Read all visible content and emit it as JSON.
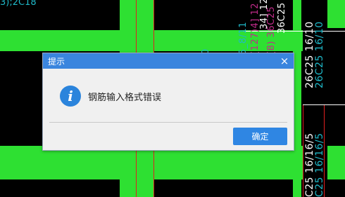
{
  "background": {
    "texts": [
      {
        "text": "3);2C18",
        "color": "#1fb8c8"
      },
      {
        "text": "0",
        "color": "#1fb8c8"
      },
      {
        "text": "5_8/11",
        "color": "#1fb8c8"
      },
      {
        "text": "(127)4] 12",
        "color": "#c02b8a"
      },
      {
        "text": "34] 12",
        "color": "#ffffff"
      },
      {
        "text": "(8) 36C25",
        "color": "#c02b8a"
      },
      {
        "text": "36C25",
        "color": "#ffffff"
      },
      {
        "text": "26C25 16/10",
        "color": "#ffffff"
      },
      {
        "text": "26C25 16/10",
        "color": "#1fb8c8"
      },
      {
        "text": "C25 16/16/5",
        "color": "#ffffff"
      },
      {
        "text": "C25 16/16/5",
        "color": "#1fb8c8"
      }
    ]
  },
  "dialog": {
    "title": "提示",
    "close_glyph": "×",
    "icon": "info-icon",
    "icon_glyph": "i",
    "message": "钢筋输入格式错误",
    "ok_label": "确定",
    "accent_color": "#3a85de",
    "button_color": "#2f86e3"
  }
}
